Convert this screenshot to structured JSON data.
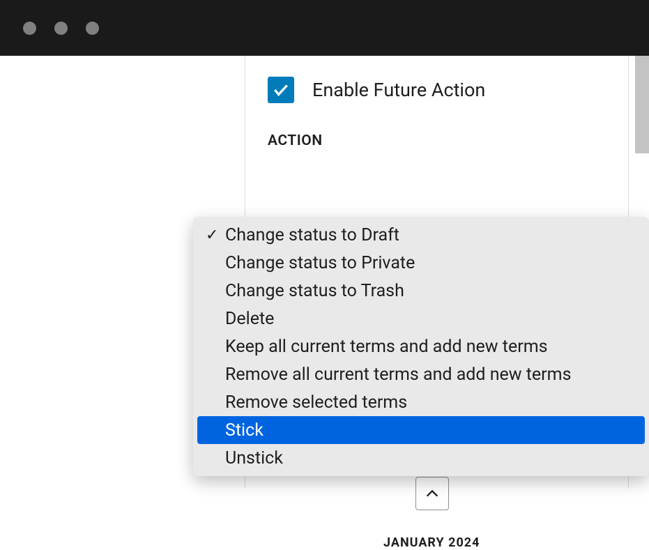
{
  "checkbox": {
    "label": "Enable Future Action",
    "checked": true
  },
  "section": {
    "label": "ACTION"
  },
  "dropdown": {
    "selectedIndex": 0,
    "highlightedIndex": 7,
    "items": [
      "Change status to Draft",
      "Change status to Private",
      "Change status to Trash",
      "Delete",
      "Keep all current terms and add new terms",
      "Remove all current terms and add new terms",
      "Remove selected terms",
      "Stick",
      "Unstick"
    ]
  },
  "calendar": {
    "monthLabel": "JANUARY 2024"
  }
}
